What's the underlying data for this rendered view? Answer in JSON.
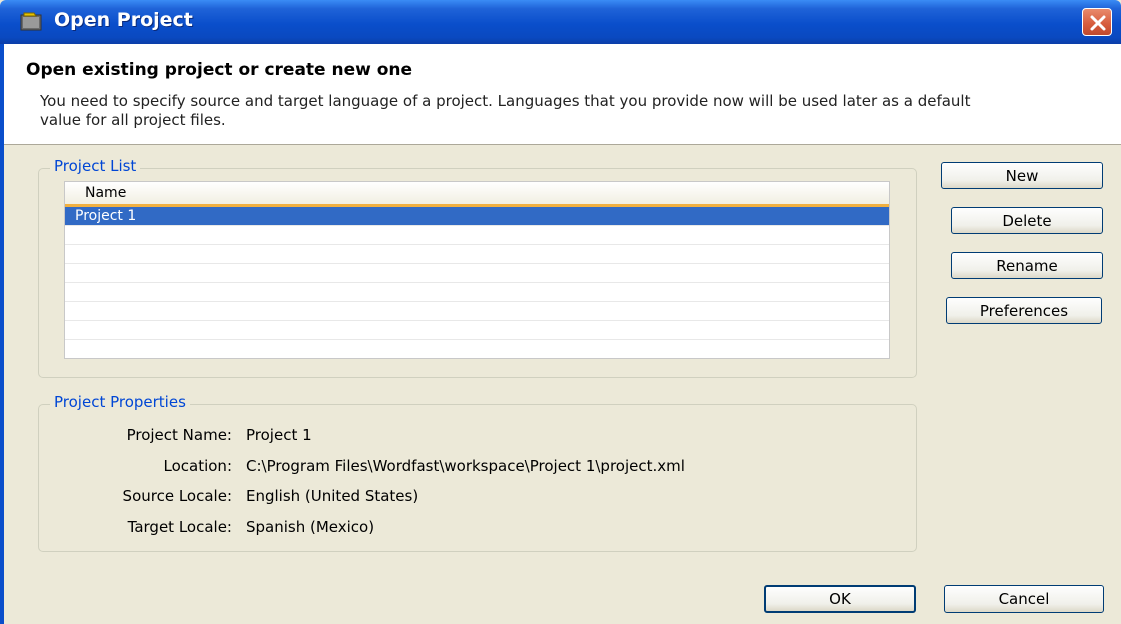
{
  "window": {
    "title": "Open Project",
    "icon": "project-icon",
    "close_icon": "close-icon"
  },
  "header": {
    "title": "Open existing project or create new one",
    "description": "You need to specify source and target language of a project. Languages that you provide now will be used later as a default value for all project files."
  },
  "project_list": {
    "group_label": "Project List",
    "column_header": "Name",
    "rows": [
      "Project 1",
      "",
      "",
      "",
      "",
      "",
      "",
      ""
    ],
    "selected_row": "Project 1"
  },
  "side_buttons": {
    "new": "New",
    "delete": "Delete",
    "rename": "Rename",
    "preferences": "Preferences"
  },
  "project_properties": {
    "group_label": "Project Properties",
    "name_label": "Project Name:",
    "name_value": "Project 1",
    "location_label": "Location:",
    "location_value": "C:\\Program Files\\Wordfast\\workspace\\Project 1\\project.xml",
    "source_label": "Source Locale:",
    "source_value": "English (United States)",
    "target_label": "Target Locale:",
    "target_value": "Spanish (Mexico)"
  },
  "footer": {
    "ok": "OK",
    "cancel": "Cancel"
  },
  "colors": {
    "titlebar": "#0a4ecb",
    "selection": "#316ac5",
    "group_label": "#0046d5",
    "dialog_bg": "#ece9d8"
  }
}
